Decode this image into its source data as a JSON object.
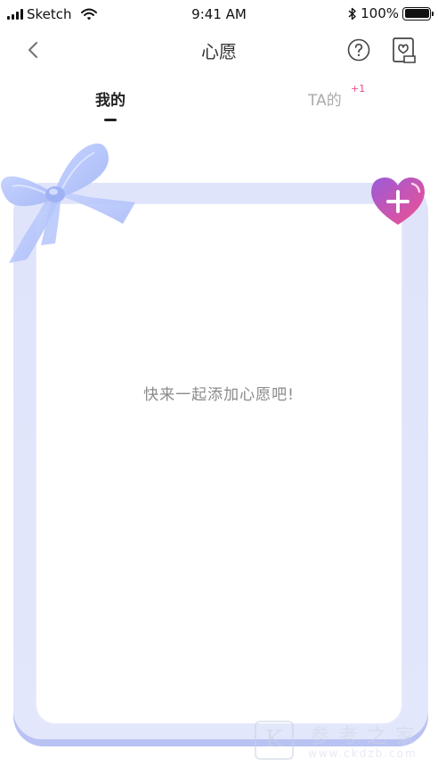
{
  "status_bar": {
    "carrier": "Sketch",
    "time": "9:41 AM",
    "battery": "100%",
    "icons": [
      "signal-icon",
      "wifi-icon",
      "bluetooth-icon",
      "battery-icon"
    ]
  },
  "nav": {
    "title": "心愿",
    "icons": [
      "back-chevron-icon",
      "help-question-icon",
      "wish-record-icon"
    ]
  },
  "tabs": {
    "mine": "我的",
    "ta": "TA的",
    "ta_badge": "+1"
  },
  "card": {
    "empty_message": "快来一起添加心愿吧!",
    "icons": [
      "bow-ribbon-icon",
      "heart-plus-icon"
    ]
  },
  "watermark": {
    "letter": "K",
    "chars": "参考之家",
    "url": "www.ckdzb.com"
  },
  "colors": {
    "frame": "#dfe4fb",
    "frame_shadow": "#b9c2f3",
    "bow": "#b8c8fb",
    "heart_start": "#9b5bd9",
    "heart_end": "#f0508f",
    "badge": "#e24b8b"
  }
}
